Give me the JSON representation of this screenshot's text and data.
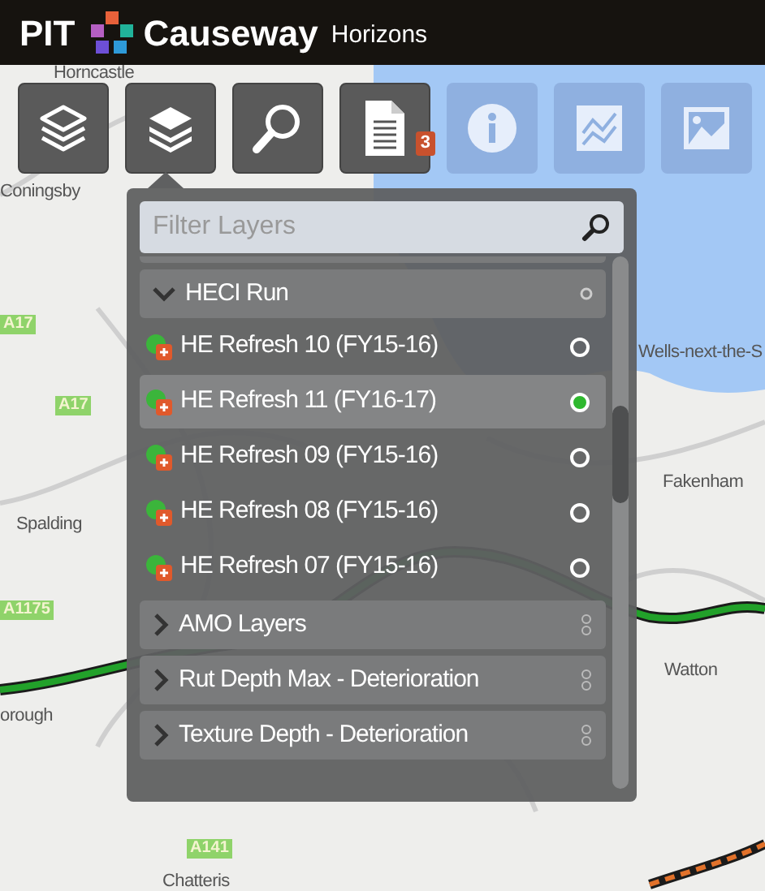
{
  "header": {
    "app_name": "PIT",
    "brand": "Causeway",
    "product": "Horizons"
  },
  "toolbar": [
    {
      "kind": "layers-outline",
      "disabled": false
    },
    {
      "kind": "layers",
      "disabled": false
    },
    {
      "kind": "search",
      "disabled": false
    },
    {
      "kind": "document",
      "disabled": false,
      "badge": "3"
    },
    {
      "kind": "info",
      "disabled": true
    },
    {
      "kind": "chart",
      "disabled": true
    },
    {
      "kind": "image",
      "disabled": true
    }
  ],
  "map_labels": [
    {
      "text": "Horncastle",
      "kind": "place"
    },
    {
      "text": "Coningsby",
      "kind": "place"
    },
    {
      "text": "A17",
      "kind": "road"
    },
    {
      "text": "A17",
      "kind": "road"
    },
    {
      "text": "Wells-next-the-S",
      "kind": "place"
    },
    {
      "text": "Fakenham",
      "kind": "place"
    },
    {
      "text": "Spalding",
      "kind": "place"
    },
    {
      "text": "A1175",
      "kind": "road"
    },
    {
      "text": "Watton",
      "kind": "place"
    },
    {
      "text": "orough",
      "kind": "place"
    },
    {
      "text": "A141",
      "kind": "road"
    },
    {
      "text": "Chatteris",
      "kind": "place"
    }
  ],
  "layer_panel": {
    "filter": {
      "placeholder": "Filter Layers"
    },
    "groups": [
      {
        "label": "HECI Run",
        "expanded": true,
        "children": [
          {
            "label": "HE Refresh 10 (FY15-16)",
            "selected": false
          },
          {
            "label": "HE Refresh 11 (FY16-17)",
            "selected": true
          },
          {
            "label": "HE Refresh 09 (FY15-16)",
            "selected": false
          },
          {
            "label": "HE Refresh 08 (FY15-16)",
            "selected": false
          },
          {
            "label": "HE Refresh 07 (FY15-16)",
            "selected": false
          }
        ]
      },
      {
        "label": "AMO Layers",
        "expanded": false
      },
      {
        "label": "Rut Depth Max - Deterioration",
        "expanded": false
      },
      {
        "label": "Texture Depth - Deterioration",
        "expanded": false
      }
    ]
  }
}
